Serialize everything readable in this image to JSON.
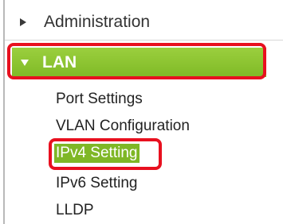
{
  "nav": {
    "administration": {
      "label": "Administration",
      "icon": "triangle-right-icon"
    },
    "lan": {
      "label": "LAN",
      "icon": "triangle-down-icon",
      "color": "#8cc43a"
    },
    "lan_items": [
      {
        "label": "Port Settings"
      },
      {
        "label": "VLAN Configuration"
      },
      {
        "label": "IPv4 Setting",
        "selected": true
      },
      {
        "label": "IPv6 Setting"
      },
      {
        "label": "LLDP"
      }
    ],
    "highlight_color": "#e8101f"
  }
}
